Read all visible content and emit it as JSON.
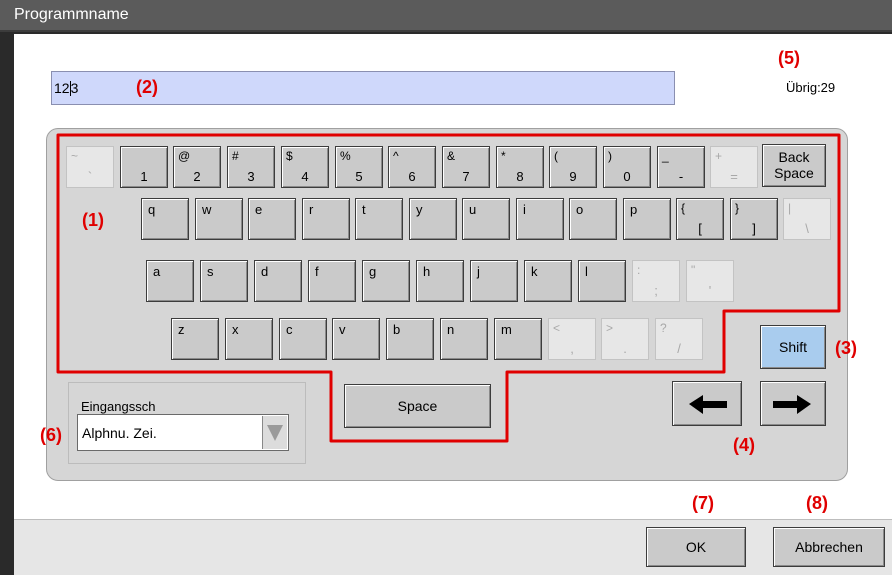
{
  "window": {
    "title": "Programmname"
  },
  "input": {
    "value_before": "12",
    "value_after": "3",
    "remaining_label": "Übrig:29"
  },
  "keyboard": {
    "row1": [
      {
        "top": "~",
        "bot": "`",
        "disabled": true
      },
      {
        "top": "",
        "bot": "1"
      },
      {
        "top": "@",
        "bot": "2"
      },
      {
        "top": "#",
        "bot": "3"
      },
      {
        "top": "$",
        "bot": "4"
      },
      {
        "top": "%",
        "bot": "5"
      },
      {
        "top": "^",
        "bot": "6"
      },
      {
        "top": "&",
        "bot": "7"
      },
      {
        "top": "*",
        "bot": "8"
      },
      {
        "top": "(",
        "bot": "9"
      },
      {
        "top": ")",
        "bot": "0"
      },
      {
        "top": "_",
        "bot": "-"
      },
      {
        "top": "+",
        "bot": "=",
        "disabled": true
      }
    ],
    "backspace_line1": "Back",
    "backspace_line2": "Space",
    "row2": [
      {
        "top": "q"
      },
      {
        "top": "w"
      },
      {
        "top": "e"
      },
      {
        "top": "r"
      },
      {
        "top": "t"
      },
      {
        "top": "y"
      },
      {
        "top": "u"
      },
      {
        "top": "i"
      },
      {
        "top": "o"
      },
      {
        "top": "p"
      },
      {
        "top": "{",
        "bot": "["
      },
      {
        "top": "}",
        "bot": "]"
      },
      {
        "top": "|",
        "bot": "\\",
        "disabled": true
      }
    ],
    "row3": [
      {
        "top": "a"
      },
      {
        "top": "s"
      },
      {
        "top": "d"
      },
      {
        "top": "f"
      },
      {
        "top": "g"
      },
      {
        "top": "h"
      },
      {
        "top": "j"
      },
      {
        "top": "k"
      },
      {
        "top": "l"
      },
      {
        "top": ":",
        "bot": ";",
        "disabled": true
      },
      {
        "top": "\"",
        "bot": "'",
        "disabled": true
      }
    ],
    "row4": [
      {
        "top": "z"
      },
      {
        "top": "x"
      },
      {
        "top": "c"
      },
      {
        "top": "v"
      },
      {
        "top": "b"
      },
      {
        "top": "n"
      },
      {
        "top": "m"
      },
      {
        "top": "<",
        "bot": ",",
        "disabled": true
      },
      {
        "top": ">",
        "bot": ".",
        "disabled": true
      },
      {
        "top": "?",
        "bot": "/",
        "disabled": true
      }
    ],
    "shift_label": "Shift",
    "space_label": "Space",
    "arrow_left": "🡐",
    "arrow_right": "🡒"
  },
  "input_type": {
    "label": "Eingangssch",
    "value": "Alphnu. Zei."
  },
  "footer": {
    "ok_label": "OK",
    "cancel_label": "Abbrechen"
  },
  "annotations": {
    "a1": "(1)",
    "a2": "(2)",
    "a3": "(3)",
    "a4": "(4)",
    "a5": "(5)",
    "a6": "(6)",
    "a7": "(7)",
    "a8": "(8)"
  },
  "colors": {
    "annotation": "#e00000",
    "field_bg": "#cfd8fb",
    "shift_bg": "#a9ccee"
  }
}
